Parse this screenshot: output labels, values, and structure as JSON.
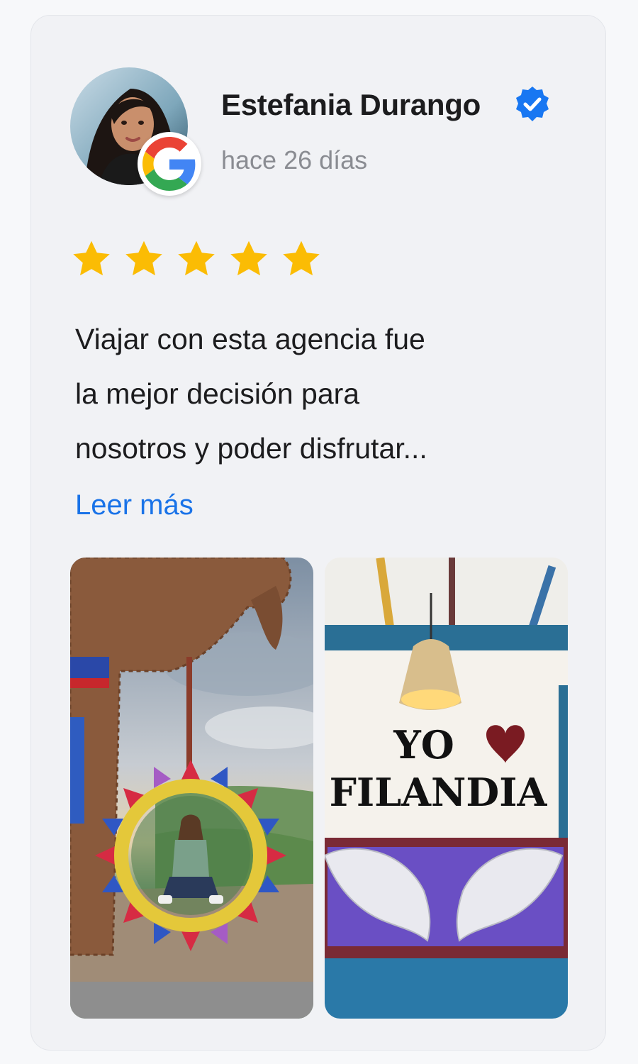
{
  "review": {
    "author_name": "Estefania Durango",
    "verified_icon": "verified-badge-icon",
    "source_icon": "google-logo-icon",
    "time_ago": "hace 26 días",
    "rating": 5,
    "rating_max": 5,
    "text_lines": [
      "Viajar con esta agencia fue",
      "la mejor decisión para",
      "nosotros y poder disfrutar..."
    ],
    "read_more_label": "Leer más",
    "photos": [
      {
        "sign_text": ""
      },
      {
        "sign_line_1": "YO",
        "sign_line_2": "FILANDIA"
      }
    ]
  },
  "colors": {
    "accent_link": "#1a73e8",
    "verified_blue": "#1877f2",
    "star_yellow": "#fbbc04",
    "card_bg": "#f1f2f5"
  }
}
